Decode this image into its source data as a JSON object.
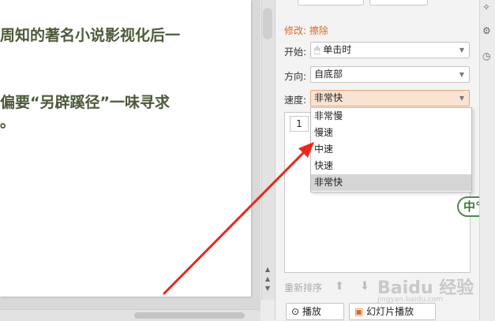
{
  "slide": {
    "line1": "周知的著名小说影视化后一",
    "line2": "偏要“另辟蹊径”一味寻求",
    "line3": "。"
  },
  "animation_pane": {
    "effect_title": "修改: 擦除",
    "start_label": "开始:",
    "start_value": "单击时",
    "direction_label": "方向:",
    "direction_value": "自底部",
    "speed_label": "速度:",
    "speed_value": "非常快",
    "list_item_number": "1",
    "reorder_label": "重新排序",
    "play_button": "播放",
    "slideshow_button": "幻灯片播放"
  },
  "speed_dropdown": {
    "options": [
      "非常慢",
      "慢速",
      "中速",
      "快速",
      "非常快"
    ],
    "selected": "非常快"
  },
  "watermark": {
    "text": "Baidu 经验",
    "sub": "jingyan.baidu.com"
  },
  "badge": {
    "text": "中°,"
  },
  "icons": {
    "play": "play-icon",
    "slideshow": "slideshow-icon",
    "move_up": "arrow-up-icon",
    "move_down": "arrow-down-icon",
    "caret": "chevron-down-icon",
    "mouse": "mouse-icon"
  },
  "colors": {
    "accent_orange": "#d96a2b",
    "selection_highlight": "#d5d5d5",
    "annotation_arrow": "#e8281e",
    "badge_green": "#4f8a4b"
  }
}
